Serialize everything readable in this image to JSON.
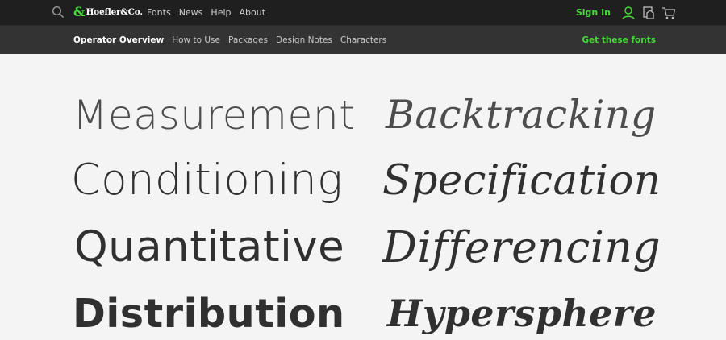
{
  "header": {
    "brand_amp": "&",
    "brand_name": "Hoefler&Co.",
    "nav": [
      "Fonts",
      "News",
      "Help",
      "About"
    ],
    "signin": "Sign In",
    "icons": [
      "search-icon",
      "user-icon",
      "favorites-icon",
      "cart-icon"
    ],
    "accent_color": "#46d93a"
  },
  "subnav": {
    "items": [
      "Operator Overview",
      "How to Use",
      "Packages",
      "Design Notes",
      "Characters"
    ],
    "active": "Operator Overview",
    "cta": "Get these fonts"
  },
  "specimen": {
    "roman": [
      "Measurement",
      "Conditioning",
      "Quantitative",
      "Distribution"
    ],
    "italic": [
      "Backtracking",
      "Specification",
      "Differencing",
      "Hypersphere"
    ]
  }
}
